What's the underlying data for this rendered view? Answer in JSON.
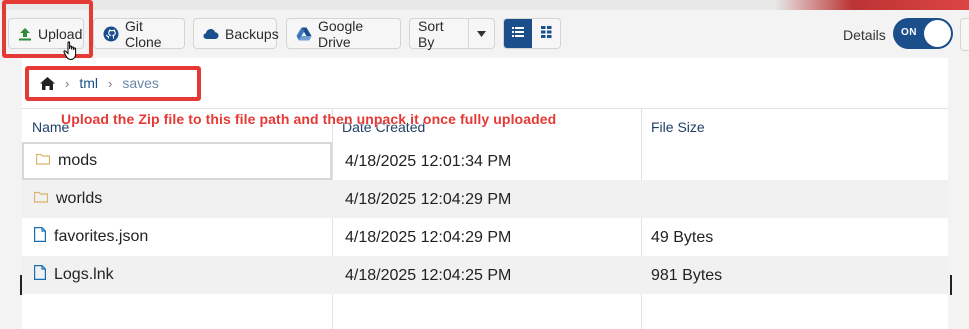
{
  "toolbar": {
    "upload_label": "Upload",
    "git_clone_label": "Git Clone",
    "backups_label": "Backups",
    "google_drive_label": "Google Drive",
    "sort_label": "Sort By",
    "details_label": "Details",
    "details_toggle_text": "ON"
  },
  "breadcrumb": {
    "items": [
      "tml",
      "saves"
    ]
  },
  "table": {
    "headers": [
      "Name",
      "Date Created",
      "File Size"
    ],
    "rows": [
      {
        "icon": "folder-icon",
        "name": "mods",
        "date": "4/18/2025 12:01:34 PM",
        "size": ""
      },
      {
        "icon": "folder-icon",
        "name": "worlds",
        "date": "4/18/2025 12:04:29 PM",
        "size": ""
      },
      {
        "icon": "file-icon",
        "name": "favorites.json",
        "date": "4/18/2025 12:04:29 PM",
        "size": "49 Bytes"
      },
      {
        "icon": "file-icon",
        "name": "Logs.lnk",
        "date": "4/18/2025 12:04:25 PM",
        "size": "981 Bytes"
      }
    ]
  },
  "annotation_text": "Upload the Zip file to this file path and then unpack it once fully uploaded",
  "colors": {
    "accent": "#1b4f8c",
    "highlight_red": "#e53935",
    "folder": "#d9b46a",
    "file": "#1b6fb0"
  }
}
